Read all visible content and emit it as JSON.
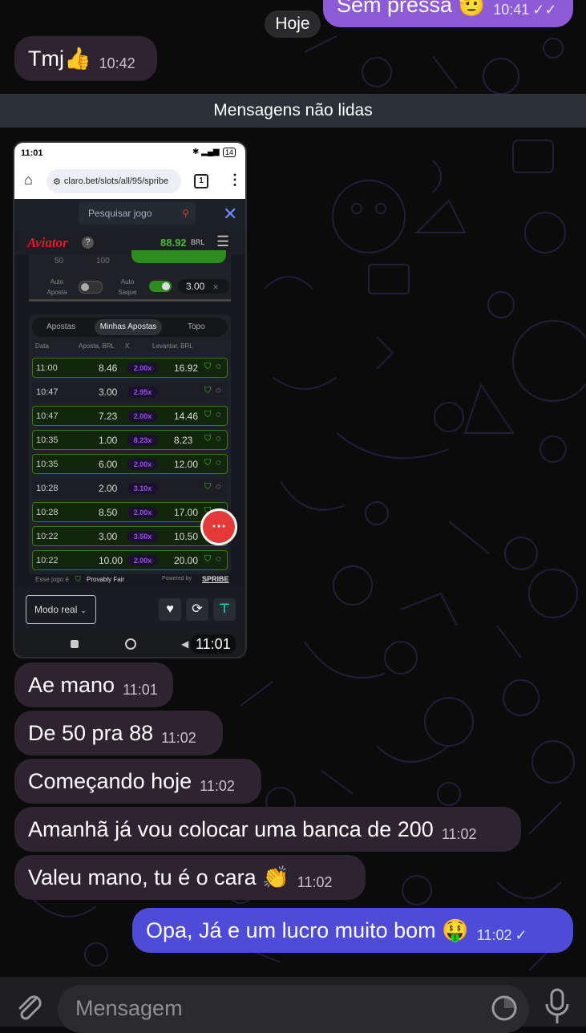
{
  "chat": {
    "top_partial_message": {
      "text": "Sem pressa 🫡",
      "time": "10:41"
    },
    "date_label": "Hoje",
    "first_in_message": {
      "text": "Tmj👍",
      "time": "10:42"
    },
    "unread_banner": "Mensagens não lidas",
    "image_time": "11:01",
    "incoming": [
      {
        "text": "Ae mano",
        "time": "11:01"
      },
      {
        "text": "De 50 pra 88",
        "time": "11:02"
      },
      {
        "text": "Começando hoje",
        "time": "11:02"
      },
      {
        "text": "Amanhã já vou colocar uma banca de 200",
        "time": "11:02"
      },
      {
        "text": "Valeu mano, tu é o cara 👏",
        "time": "11:02"
      }
    ],
    "outgoing_last": {
      "text": "Opa, Já e um lucro muito bom 🤑",
      "time": "11:02"
    }
  },
  "composer": {
    "placeholder": "Mensagem"
  },
  "phone": {
    "status_time": "11:01",
    "battery": "14",
    "url": "claro.bet/slots/all/95/spribe",
    "tab_count": "1",
    "search_placeholder": "Pesquisar jogo",
    "game_logo": "Aviator",
    "help_symbol": "?",
    "balance": "88.92",
    "currency": "BRL",
    "bet_amounts": [
      "50",
      "100"
    ],
    "auto_bet_label": "Auto Aposta",
    "auto_cashout_label": "Auto Saque",
    "auto_cashout_value": "3.00",
    "tabs": [
      "Apostas",
      "Minhas Apostas",
      "Topo"
    ],
    "columns": [
      "Data",
      "Aposta, BRL",
      "X",
      "Levantar, BRL"
    ],
    "rows": [
      {
        "time": "11:00",
        "bet": "8.46",
        "mult": "2.00x",
        "cashout": "16.92",
        "win": true
      },
      {
        "time": "10:47",
        "bet": "3.00",
        "mult": "2.95x",
        "cashout": "",
        "win": false
      },
      {
        "time": "10:47",
        "bet": "7.23",
        "mult": "2.00x",
        "cashout": "14.46",
        "win": true
      },
      {
        "time": "10:35",
        "bet": "1.00",
        "mult": "8.23x",
        "cashout": "8.23",
        "win": true
      },
      {
        "time": "10:35",
        "bet": "6.00",
        "mult": "2.00x",
        "cashout": "12.00",
        "win": true
      },
      {
        "time": "10:28",
        "bet": "2.00",
        "mult": "3.10x",
        "cashout": "",
        "win": false
      },
      {
        "time": "10:28",
        "bet": "8.50",
        "mult": "2.00x",
        "cashout": "17.00",
        "win": true
      },
      {
        "time": "10:22",
        "bet": "3.00",
        "mult": "3.50x",
        "cashout": "10.50",
        "win": true
      },
      {
        "time": "10:22",
        "bet": "10.00",
        "mult": "2.00x",
        "cashout": "20.00",
        "win": true
      }
    ],
    "fair_prefix": "Esse jogo é",
    "fair_label": "Provably Fair",
    "powered_by": "Powered by",
    "spribe": "SPRIBE",
    "mode_label": "Modo real"
  },
  "colors": {
    "incoming_bubble": "#2e2331",
    "outgoing_bubble": "#4f4bd9",
    "accent_green": "#3fbf2c"
  }
}
